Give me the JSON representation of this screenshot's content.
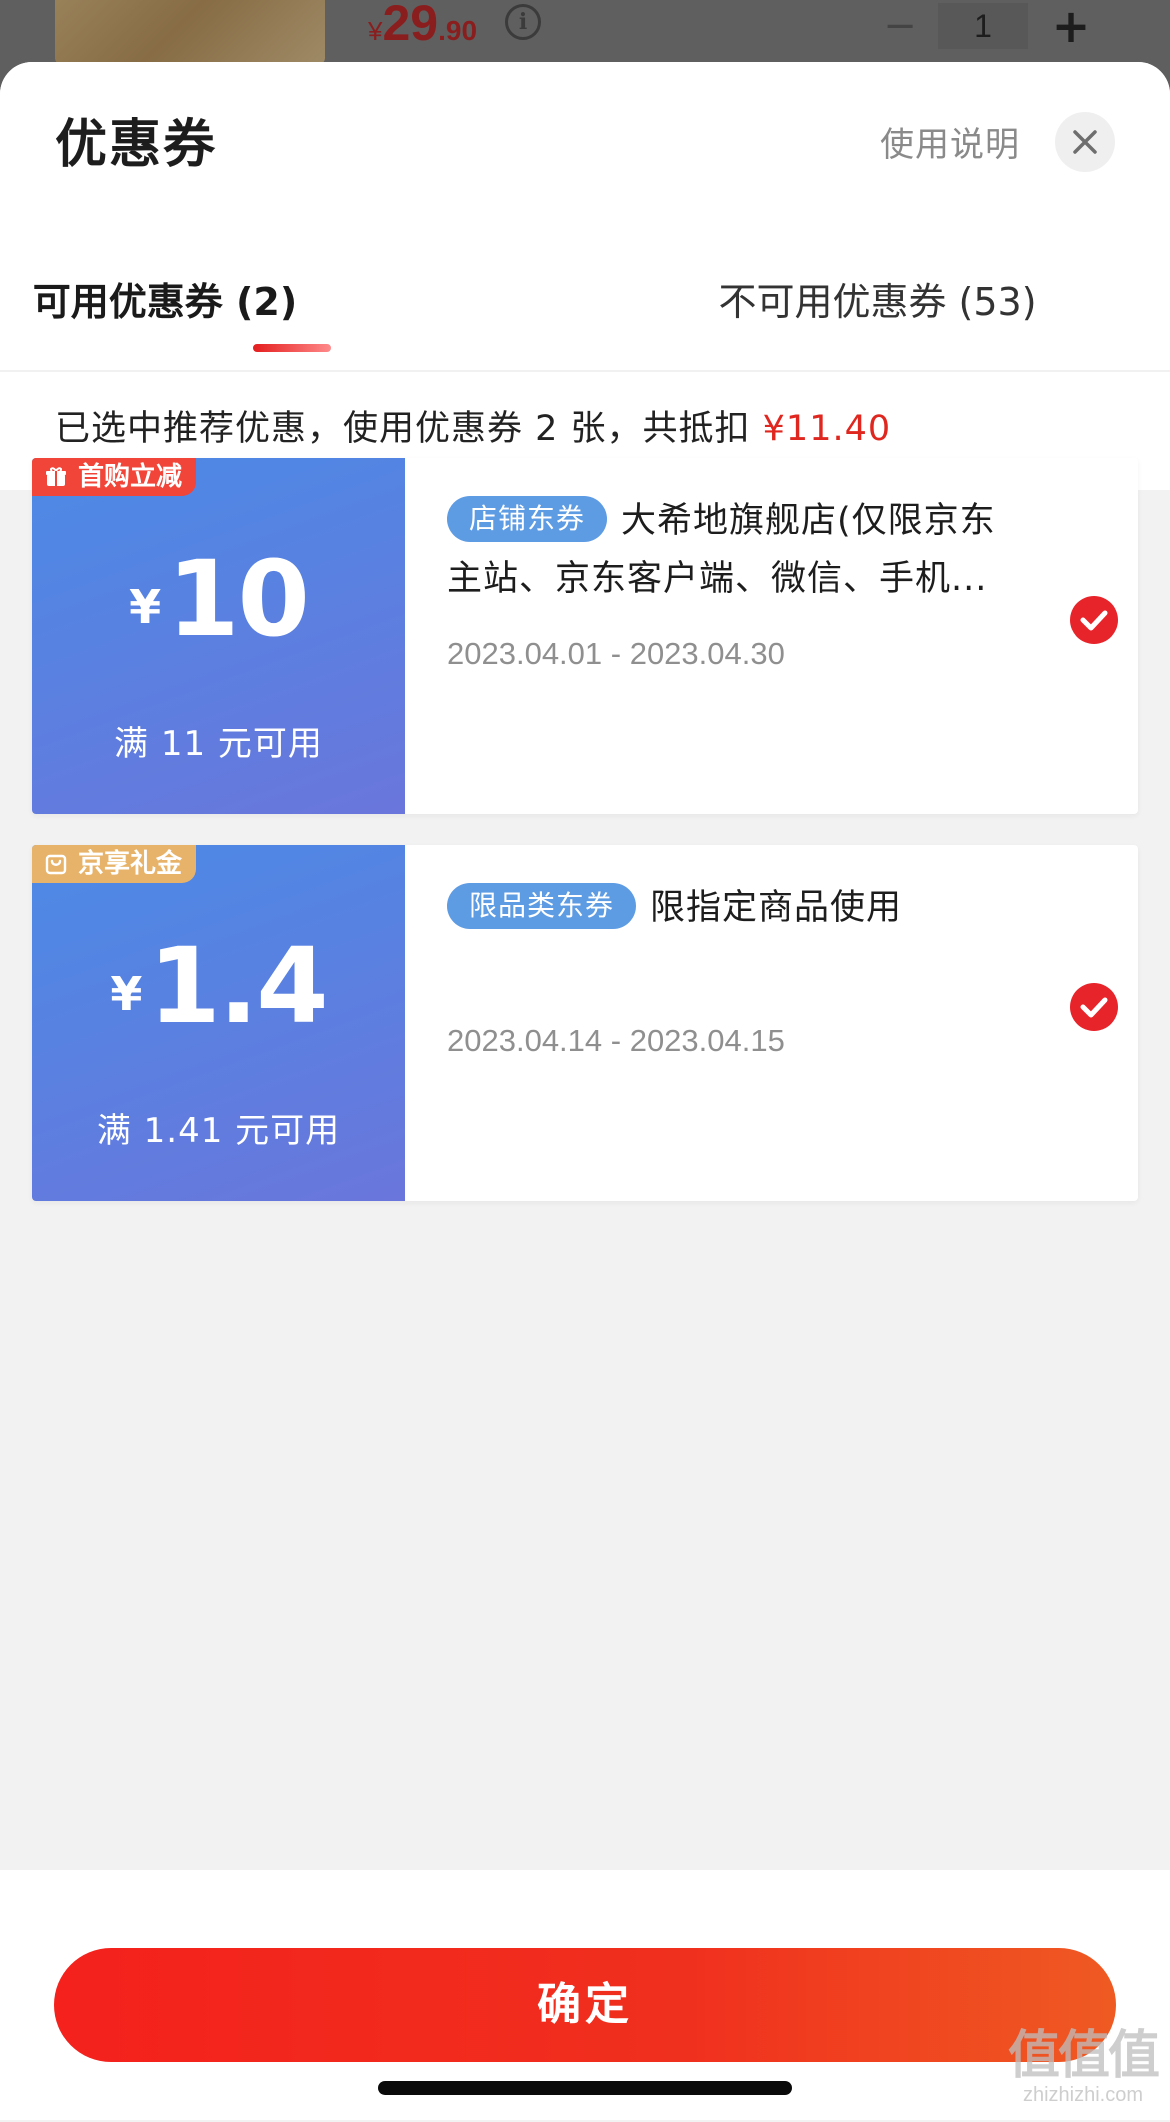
{
  "background": {
    "price_symbol": "¥",
    "price_integer": "29",
    "price_decimal": ".90",
    "info_glyph": "i",
    "minus_label": "−",
    "quantity": "1",
    "plus_label": "+"
  },
  "sheet": {
    "title": "优惠券",
    "help_link": "使用说明",
    "close_icon": "close-icon"
  },
  "tabs": [
    {
      "label": "可用优惠券 (2)",
      "active": true
    },
    {
      "label": "不可用优惠券 (53)",
      "active": false
    }
  ],
  "summary": {
    "text": "已选中推荐优惠，使用优惠券 2 张，共抵扣 ",
    "amount": "¥11.40"
  },
  "coupons": [
    {
      "tag": "首购立减",
      "tag_icon": "gift-icon",
      "currency": "¥",
      "amount": "10",
      "condition": "满 11 元可用",
      "type_label": "店铺东券",
      "desc_line1": "大希地旗舰店(仅限京东",
      "desc_line2": "主站、京东客户端、微信、手机...",
      "date_range": "2023.04.01 - 2023.04.30",
      "selected": true
    },
    {
      "tag": "京享礼金",
      "tag_icon": "bag-icon",
      "currency": "¥",
      "amount": "1.4",
      "condition": "满 1.41 元可用",
      "type_label": "限品类东券",
      "desc_line1": "限指定商品使用",
      "desc_line2": "",
      "date_range": "2023.04.14 - 2023.04.15",
      "selected": true
    }
  ],
  "footer": {
    "confirm_label": "确定"
  },
  "watermark": {
    "main": "值值值",
    "sub": "zhizhizhi.com"
  },
  "colors": {
    "accent_red": "#e0271f",
    "coupon_blue": "#5c7fe0",
    "pill_blue": "#5d9be3",
    "tag_red": "#f04538",
    "tag_gold": "#e7b36a"
  }
}
